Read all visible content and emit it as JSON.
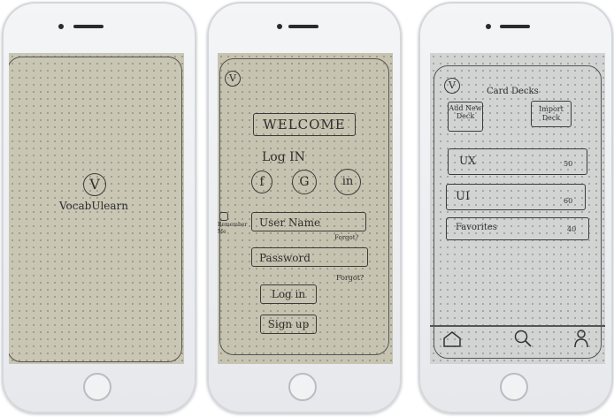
{
  "splash": {
    "logo_letter": "V",
    "app_name": "VocabUlearn"
  },
  "login": {
    "corner_logo": "V",
    "welcome": "WELCOME",
    "heading": "Log IN",
    "social": [
      "f",
      "G",
      "in"
    ],
    "remember_label": "Remember Me",
    "username_placeholder": "User Name",
    "forgot_username": "Forgot?",
    "password_placeholder": "Password",
    "forgot_password": "Forgot?",
    "login_button": "Log in",
    "signup_button": "Sign up"
  },
  "decks_screen": {
    "corner_logo": "V",
    "title": "Card Decks",
    "add_new_deck": "Add New Deck",
    "import_deck": "Import Deck",
    "decks": [
      {
        "name": "UX",
        "count": "50"
      },
      {
        "name": "UI",
        "count": "60"
      },
      {
        "name": "Favorites",
        "count": "40"
      }
    ],
    "nav_icons": [
      "home-icon",
      "search-icon",
      "profile-icon"
    ]
  }
}
